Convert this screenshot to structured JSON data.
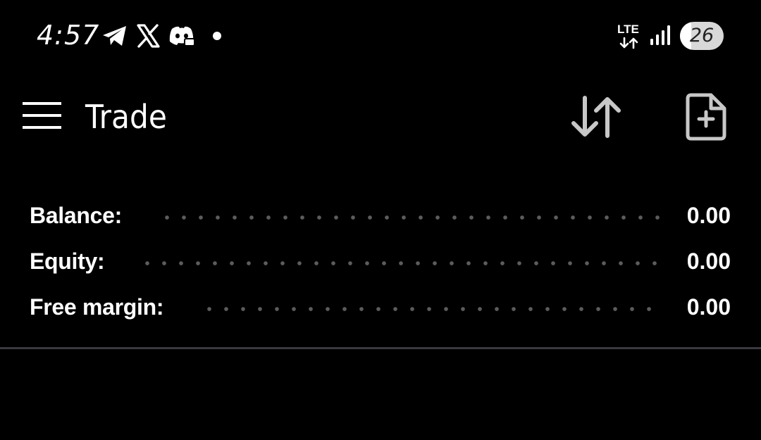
{
  "status_bar": {
    "time": "4:57",
    "notification_icons": [
      "telegram-icon",
      "x-icon",
      "discord-icon",
      "dot-icon"
    ],
    "network_label": "LTE",
    "battery_level": "26",
    "battery_percent": 26
  },
  "app_bar": {
    "title": "Trade",
    "menu_icon": "hamburger-icon",
    "sort_icon": "sort-arrows-icon",
    "new_order_icon": "file-plus-icon"
  },
  "account_summary": {
    "rows": [
      {
        "label": "Balance:",
        "value": "0.00"
      },
      {
        "label": "Equity:",
        "value": "0.00"
      },
      {
        "label": "Free margin:",
        "value": "0.00"
      }
    ]
  },
  "colors": {
    "background": "#000000",
    "text": "#ffffff",
    "icon_gray": "#c8c8c8",
    "leader_dots": "#5c5c5c",
    "divider": "#3a3a3f"
  }
}
